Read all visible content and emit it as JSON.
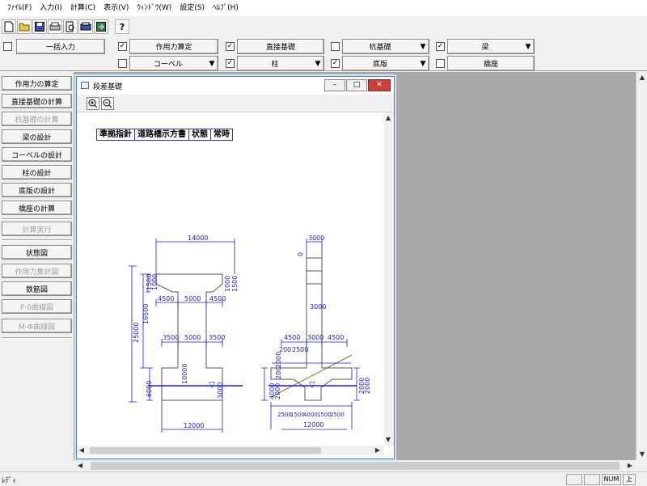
{
  "menu": [
    "ﾌｧｲﾙ(F)",
    "入力(I)",
    "計算(C)",
    "表示(V)",
    "ｳｨﾝﾄﾞｳ(W)",
    "設定(S)",
    "ﾍﾙﾌﾟ(H)"
  ],
  "toolbar": {
    "icons": [
      "new-file-icon",
      "open-folder-icon",
      "save-icon",
      "print-icon",
      "print-preview-icon",
      "printer-setup-icon",
      "export-icon",
      "help-icon"
    ],
    "bulk_input": "一括入力",
    "row1": [
      {
        "label": "作用力算定",
        "checked": true,
        "dropdown": false
      },
      {
        "label": "直接基礎",
        "checked": true,
        "dropdown": false
      },
      {
        "label": "杭基礎",
        "checked": false,
        "dropdown": true
      },
      {
        "label": "梁",
        "checked": true,
        "dropdown": true
      }
    ],
    "row2": [
      {
        "label": "コーベル",
        "checked": false,
        "dropdown": true
      },
      {
        "label": "柱",
        "checked": true,
        "dropdown": true
      },
      {
        "label": "底版",
        "checked": true,
        "dropdown": true
      },
      {
        "label": "橋座",
        "checked": false,
        "dropdown": false
      }
    ]
  },
  "left_panel": [
    {
      "label": "作用力の算定",
      "enabled": true
    },
    {
      "label": "直接基礎の計算",
      "enabled": true
    },
    {
      "label": "杭基礎の計算",
      "enabled": false
    },
    {
      "label": "梁の設計",
      "enabled": true
    },
    {
      "label": "コーベルの設計",
      "enabled": true
    },
    {
      "label": "柱の設計",
      "enabled": true
    },
    {
      "label": "底版の設計",
      "enabled": true
    },
    {
      "label": "橋座の計算",
      "enabled": true
    },
    {
      "label": "計算実行",
      "enabled": false
    },
    {
      "label": "状態図",
      "enabled": true
    },
    {
      "label": "作用力集計図",
      "enabled": false
    },
    {
      "label": "鉄筋図",
      "enabled": true
    },
    {
      "label": "P-δ曲線図",
      "enabled": false
    },
    {
      "label": "M-Φ曲線図",
      "enabled": false
    }
  ],
  "child_window": {
    "title": "段差基礎",
    "spec": [
      "準拠指針",
      "道路橋示方書",
      "状態",
      "常時"
    ]
  },
  "drawing": {
    "front": {
      "top_width": "14000",
      "beam_heights": [
        "1500",
        "1000",
        "1000",
        "1500"
      ],
      "upper_spans": [
        "4500",
        "5000",
        "4500"
      ],
      "lower_spans": [
        "3500",
        "5000",
        "3500"
      ],
      "total_height": "25000",
      "col_height": "16500",
      "footing_depth": "10000",
      "base_height": "6000",
      "base_inner": "3000",
      "base_width": "12000"
    },
    "side": {
      "top_width": "3000",
      "mid_height": "3000",
      "top_small": "0",
      "spans": [
        "4500",
        "3000",
        "4500"
      ],
      "dims_a": [
        "200",
        "2500"
      ],
      "dims_b": [
        "200",
        "2000"
      ],
      "left_heights": [
        "4000",
        "2000"
      ],
      "right_heights": [
        "2000",
        "2000"
      ],
      "bottom_spans": [
        "2500",
        "1500",
        "4000",
        "1500",
        "2500"
      ],
      "base_width": "12000"
    },
    "colors": {
      "dim": "#1c1ccc",
      "outline": "#555555",
      "water": "#1c1ccc",
      "slope": "#8a7a2a"
    }
  },
  "status": {
    "text": "ﾚﾃﾞｨ",
    "num": "NUM",
    "extra": "上"
  }
}
